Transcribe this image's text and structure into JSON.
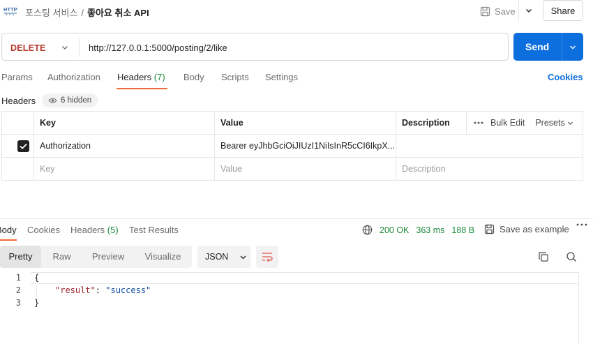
{
  "breadcrumb": {
    "icon": "http-icon",
    "parent": "포스팅 서비스",
    "separator": "/",
    "current": "좋아요 취소 API"
  },
  "toolbar": {
    "save_label": "Save",
    "share_label": "Share"
  },
  "request": {
    "method": "DELETE",
    "url": "http://127.0.0.1:5000/posting/2/like",
    "send_label": "Send"
  },
  "request_tabs": [
    {
      "label": "Params",
      "count": ""
    },
    {
      "label": "Authorization",
      "count": ""
    },
    {
      "label": "Headers",
      "count": "(7)",
      "active": true
    },
    {
      "label": "Body",
      "count": ""
    },
    {
      "label": "Scripts",
      "count": ""
    },
    {
      "label": "Settings",
      "count": ""
    }
  ],
  "cookies_label": "Cookies",
  "headers_section": {
    "label": "Headers",
    "hidden_label": "6 hidden",
    "columns": [
      "Key",
      "Value",
      "Description"
    ],
    "bulk_edit": "Bulk Edit",
    "presets": "Presets",
    "rows": [
      {
        "checked": true,
        "key": "Authorization",
        "value": "Bearer eyJhbGciOiJIUzI1NiIsInR5cCI6IkpX...",
        "description": ""
      }
    ],
    "placeholders": {
      "key": "Key",
      "value": "Value",
      "description": "Description"
    }
  },
  "response": {
    "tabs": [
      {
        "label": "Body",
        "count": "",
        "active": true
      },
      {
        "label": "Cookies",
        "count": ""
      },
      {
        "label": "Headers",
        "count": "(5)"
      },
      {
        "label": "Test Results",
        "count": ""
      }
    ],
    "status": "200 OK",
    "time": "363 ms",
    "size": "188 B",
    "save_example": "Save as example",
    "formats": [
      "Pretty",
      "Raw",
      "Preview",
      "Visualize"
    ],
    "active_format": "Pretty",
    "language": "JSON",
    "code_lines": [
      {
        "n": "1",
        "text": "{"
      },
      {
        "n": "2",
        "key": "\"result\"",
        "colon": ": ",
        "value": "\"success\""
      },
      {
        "n": "3",
        "text": "}"
      }
    ]
  },
  "colors": {
    "accent": "#0d6fde",
    "method_delete": "#b33a2e",
    "status_ok": "#1b8a3c",
    "tab_underline": "#f26b3a"
  }
}
